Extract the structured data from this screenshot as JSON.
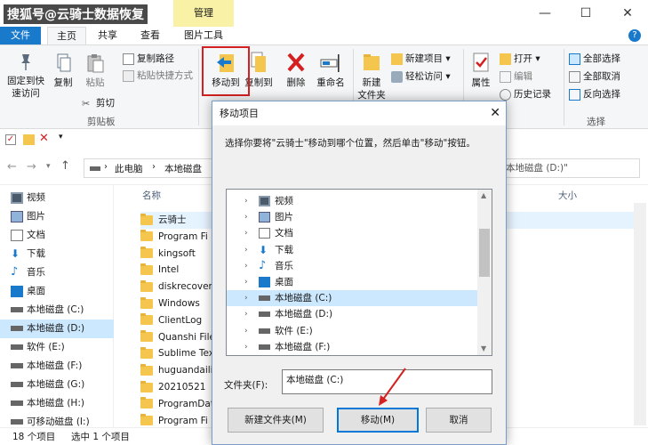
{
  "watermark": "搜狐号@云骑士数据恢复",
  "title_bar": {
    "manage_tab": "管理",
    "minimize": "—",
    "maximize": "☐",
    "close": "✕"
  },
  "tabs": {
    "file": "文件",
    "home": "主页",
    "share": "共享",
    "view": "查看",
    "picture_tools": "图片工具"
  },
  "help_icon": "?",
  "ribbon": {
    "pin_quick_access": "固定到快\n速访问",
    "copy": "复制",
    "paste": "粘贴",
    "copy_path": "复制路径",
    "paste_shortcut": "粘贴快捷方式",
    "cut": "剪切",
    "clipboard_group": "剪贴板",
    "move_to": "移动到",
    "copy_to": "复制到",
    "delete": "删除",
    "rename": "重命名",
    "new_folder": "新建\n文件夹",
    "new_item": "新建项目",
    "easy_access": "轻松访问",
    "properties": "属性",
    "open": "打开",
    "edit": "编辑",
    "history": "历史记录",
    "select_all": "全部选择",
    "select_none": "全部取消",
    "invert_selection": "反向选择",
    "select_group": "选择"
  },
  "address": {
    "path_root": "此电脑",
    "path_drive": "本地磁盘",
    "search_placeholder": "本地磁盘 (D:)\""
  },
  "nav_items": [
    {
      "label": "视频",
      "icon": "video-icon"
    },
    {
      "label": "图片",
      "icon": "pictures-icon"
    },
    {
      "label": "文档",
      "icon": "documents-icon"
    },
    {
      "label": "下载",
      "icon": "download-icon"
    },
    {
      "label": "音乐",
      "icon": "music-icon"
    },
    {
      "label": "桌面",
      "icon": "desktop-icon"
    },
    {
      "label": "本地磁盘 (C:)",
      "icon": "drive-icon"
    },
    {
      "label": "本地磁盘 (D:)",
      "icon": "drive-icon"
    },
    {
      "label": "软件 (E:)",
      "icon": "drive-icon"
    },
    {
      "label": "本地磁盘 (F:)",
      "icon": "drive-icon"
    },
    {
      "label": "本地磁盘 (G:)",
      "icon": "drive-icon"
    },
    {
      "label": "本地磁盘 (H:)",
      "icon": "drive-icon"
    },
    {
      "label": "可移动磁盘 (I:)",
      "icon": "removable-drive-icon"
    }
  ],
  "columns": {
    "name": "名称",
    "size": "大小"
  },
  "files": [
    "云骑士",
    "Program Fi",
    "kingsoft",
    "Intel",
    "diskrecover",
    "Windows",
    "ClientLog",
    "Quanshi File",
    "Sublime Tex",
    "huguandaili",
    "20210521",
    "ProgramDat",
    "Program Fi"
  ],
  "status": {
    "item_count": "18 个项目",
    "selected": "选中 1 个项目"
  },
  "dialog": {
    "title": "移动项目",
    "close": "✕",
    "instruction": "选择你要将\"云骑士\"移动到哪个位置，然后单击\"移动\"按钮。",
    "tree": [
      {
        "label": "视频",
        "icon": "video-icon"
      },
      {
        "label": "图片",
        "icon": "pictures-icon"
      },
      {
        "label": "文档",
        "icon": "documents-icon"
      },
      {
        "label": "下载",
        "icon": "download-icon"
      },
      {
        "label": "音乐",
        "icon": "music-icon"
      },
      {
        "label": "桌面",
        "icon": "desktop-icon"
      },
      {
        "label": "本地磁盘 (C:)",
        "icon": "drive-icon"
      },
      {
        "label": "本地磁盘 (D:)",
        "icon": "drive-icon"
      },
      {
        "label": "软件 (E:)",
        "icon": "drive-icon"
      },
      {
        "label": "本地磁盘 (F:)",
        "icon": "drive-icon"
      }
    ],
    "folder_label": "文件夹(F):",
    "folder_value": "本地磁盘 (C:)",
    "new_folder_button": "新建文件夹(M)",
    "move_button": "移动(M)",
    "cancel_button": "取消"
  },
  "colors": {
    "accent": "#1979ca",
    "highlight_red": "#d42020",
    "manage_tab": "#f9f1a6",
    "selection": "#cce8ff"
  }
}
